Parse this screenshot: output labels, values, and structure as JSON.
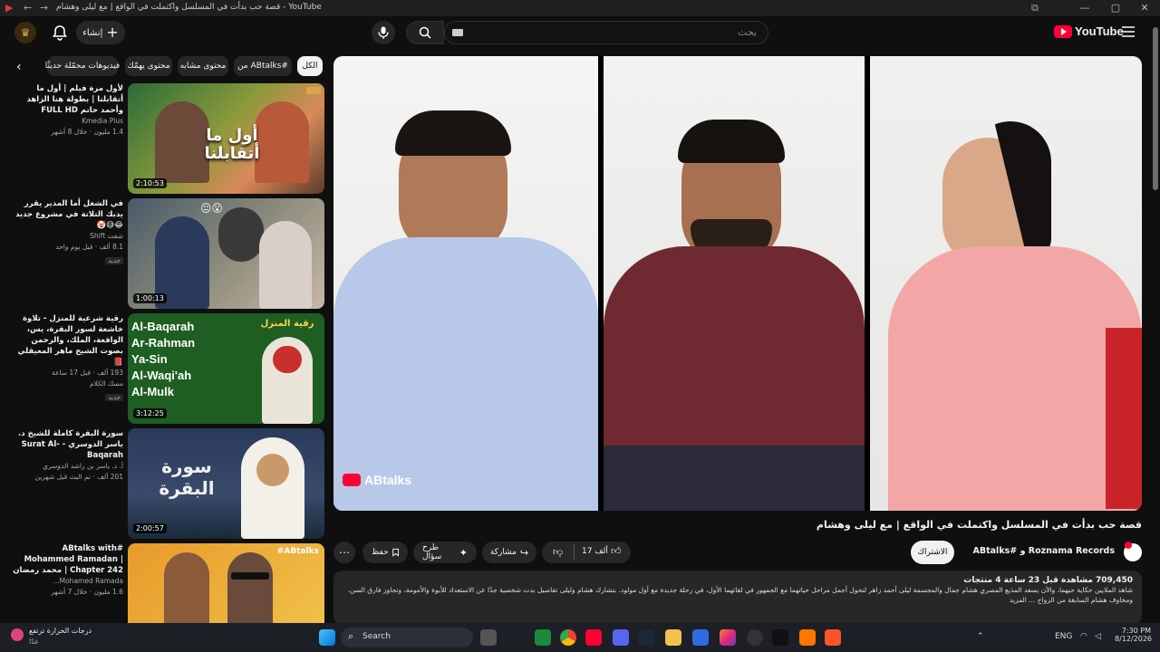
{
  "browser": {
    "tab_title": "قصة حب بدأت في المسلسل واكتملت في الواقع | مع ليلى وهشام - YouTube"
  },
  "masthead": {
    "logo_text": "YouTube",
    "search_placeholder": "بحث",
    "create_label": "إنشاء"
  },
  "chips": {
    "all": "الكل",
    "from_channel": "من ABtalks#",
    "related": "محتوى مشابه",
    "for_you": "محتوى يهمّك",
    "recently_uploaded": "فيديوهات محمّلة حديثًا"
  },
  "recommended": [
    {
      "title": "لأول مرة فيلم | أول ما أتقابلنا | بطولة هنا الزاهد وأحمد حاتم FULL HD",
      "channel": "Kmedia Plus",
      "meta": "1.4 مليون · خلال 8 أشهر",
      "duration": "2:10:53",
      "thumb_text": "أول ما أتقابلنا",
      "badge": ""
    },
    {
      "title": "في الشغل أما المدير يقرر يدبك التلاتة في مشروع جديد 😂😅🤡",
      "channel": "شفت Shift",
      "meta": "8.1 ألف · قبل يوم واحد",
      "duration": "1:00:13",
      "thumb_text": "",
      "badge": "جديد"
    },
    {
      "title": "رقية شرعية للمنزل - تلاوة خاشعة لسور البقرة، يس، الواقعة، الملك، والرحمن بصوت الشيخ ماهر المعيقلي 📕",
      "channel": "مسك الكلام",
      "meta": "193 ألف · قبل 17 ساعة",
      "duration": "3:12:25",
      "thumb_text": "رقية المنزل",
      "badge": "جديد"
    },
    {
      "title": "سورة البقرة كاملة للشيخ د. ياسر الدوسري - Surat Al-Baqarah",
      "channel": "أ. د. ياسر بن راشد الدوسري",
      "meta": "201 ألف · تم البث قبل شهرين",
      "duration": "2:00:57",
      "thumb_text": "سورة البقرة",
      "badge": ""
    },
    {
      "title": "#ABtalks with Mohammed Ramadan | Chapter 242 | محمد رمضان",
      "channel": "Mohamed Ramada...",
      "meta": "1.6 مليون · خلال 7 أشهر",
      "duration": "",
      "thumb_text": "#ABtalks",
      "badge": ""
    }
  ],
  "surah_list": [
    "Al-Baqarah",
    "Ar-Rahman",
    "Ya-Sin",
    "Al-Waqi'ah",
    "Al-Mulk"
  ],
  "player": {
    "watermark": "ABtalks"
  },
  "video": {
    "title": "قصة حب بدأت في المسلسل واكتملت في الواقع | مع ليلى وهشام",
    "channel": "ABtalks# و Roznama Records",
    "subscribe_label": "الاشتراك",
    "likes": "17 ألف",
    "share_label": "مشاركة",
    "ask_label": "طرح سؤال",
    "save_label": "حفظ",
    "views": "709,450",
    "stats": "709,450 مشاهدة قبل 23 ساعة 4 منتجات",
    "description": "شاهد الملايين حكاية حبهما، والآن يسعد المذيع المصري هشام جمال والمجسمة ليلى أحمد زاهر لتحول أجمل مراحل حياتهما مع الجمهور في لقائهما الأول، في رحلة جديدة مع أول مولود. بتشارك هشام وليلى تفاصيل بدت شخصية جدًا عن الاستعداد للأبوة والأمومة، وتجاوز فارق السن، ومخاوف هشام السابقة من الزواج ... المزيد"
  },
  "taskbar": {
    "weather_title": "درجات الحرارة ترتفع",
    "weather_sub": "غدًا",
    "search_label": "Search",
    "lang": "ENG",
    "time": "7:30 PM",
    "date": "8/12/2026"
  },
  "colors": {
    "accent_red": "#ff0033",
    "background": "#0f0f0f",
    "chip": "#272727"
  }
}
